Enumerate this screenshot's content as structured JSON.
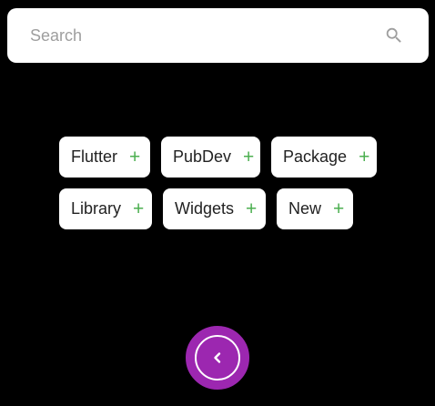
{
  "search": {
    "placeholder": "Search",
    "value": "",
    "icon": "search-icon"
  },
  "chips": [
    {
      "label": "Flutter",
      "action_symbol": "+"
    },
    {
      "label": "PubDev",
      "action_symbol": "+"
    },
    {
      "label": "Package",
      "action_symbol": "+"
    },
    {
      "label": "Library",
      "action_symbol": "+"
    },
    {
      "label": "Widgets",
      "action_symbol": "+"
    },
    {
      "label": "New",
      "action_symbol": "+"
    }
  ],
  "back_button": {
    "icon": "chevron-left-icon"
  },
  "colors": {
    "background": "#000000",
    "surface": "#ffffff",
    "add_accent": "#4caf50",
    "brand": "#9c27b0",
    "placeholder": "#9e9e9e",
    "icon": "#9e9e9e"
  }
}
